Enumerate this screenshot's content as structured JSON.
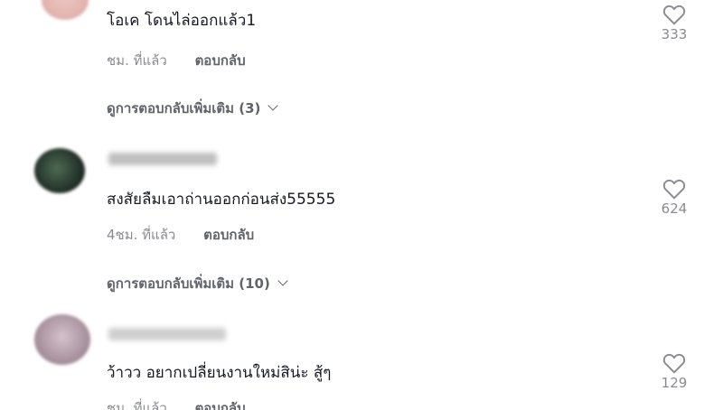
{
  "comments": [
    {
      "text": "โอเค โดนไล่ออกแล้ว1",
      "time": "ชม. ที่แล้ว",
      "reply_label": "ตอบกลับ",
      "more_replies": "ดูการตอบกลับเพิ่มเติม (3)",
      "likes": "333"
    },
    {
      "text": "สงสัยลืมเอาถ่านออกก่อนส่ง55555",
      "time": "4ชม. ที่แล้ว",
      "reply_label": "ตอบกลับ",
      "more_replies": "ดูการตอบกลับเพิ่มเติม (10)",
      "likes": "624"
    },
    {
      "text": "ว้าวว อยากเปลี่ยนงานใหม่สิน่ะ สู้ๆ",
      "time": "ชม. ที่แล้ว",
      "reply_label": "ตอบกลับ",
      "likes": "129"
    }
  ],
  "icons": {
    "like": "heart-outline-icon",
    "expand": "chevron-down-icon"
  },
  "colors": {
    "text": "#161823",
    "secondary": "#8a8b91",
    "action": "#62646b"
  }
}
